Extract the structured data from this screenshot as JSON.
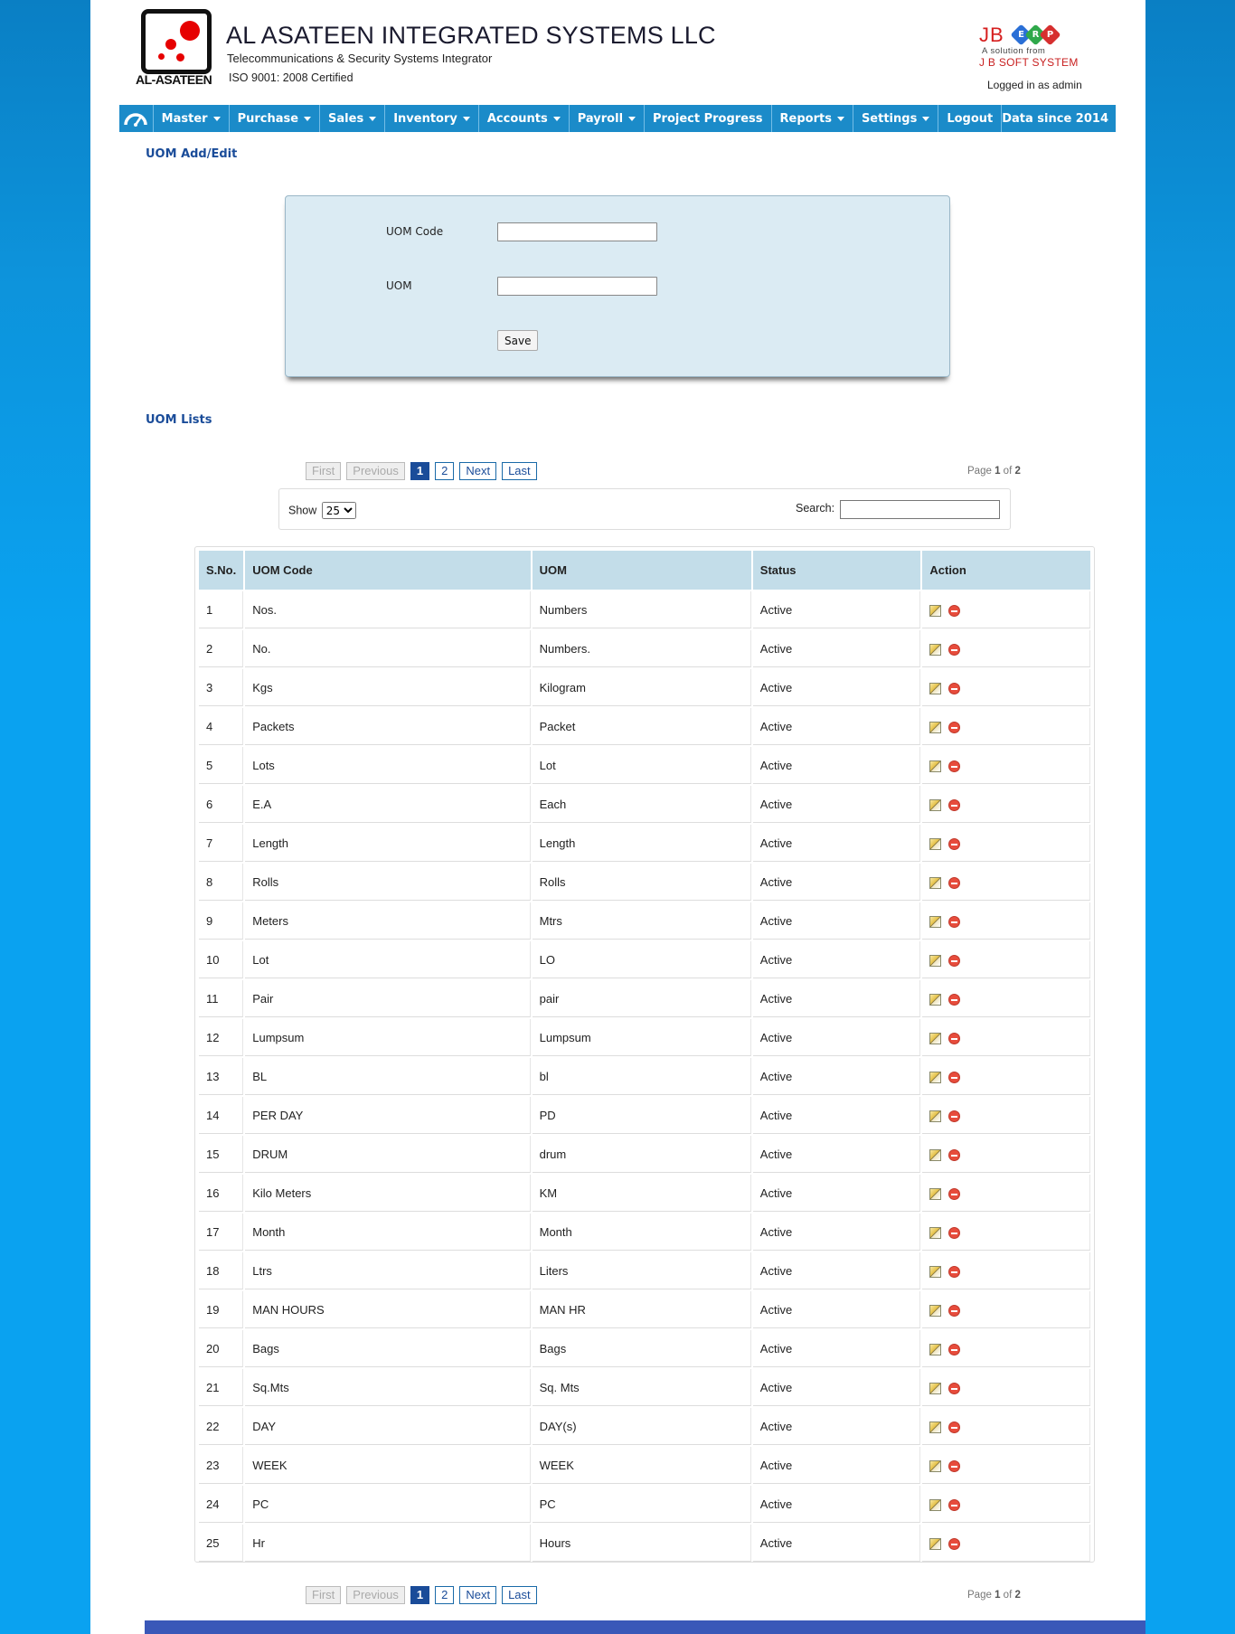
{
  "header": {
    "logo_text": "AL-ASATEEN",
    "company_name": "AL ASATEEN INTEGRATED SYSTEMS LLC",
    "tagline": "Telecommunications & Security Systems Integrator",
    "iso": "ISO 9001: 2008 Certified",
    "erp_brand": "JB",
    "erp_letters": [
      "E",
      "R",
      "P"
    ],
    "erp_sub1": "A solution from",
    "erp_sub2": "J B SOFT SYSTEM",
    "logged_in": "Logged in as admin"
  },
  "nav": {
    "home_icon": "dashboard-icon",
    "items": [
      {
        "label": "Master",
        "dropdown": true
      },
      {
        "label": "Purchase",
        "dropdown": true
      },
      {
        "label": "Sales",
        "dropdown": true
      },
      {
        "label": "Inventory",
        "dropdown": true
      },
      {
        "label": "Accounts",
        "dropdown": true
      },
      {
        "label": "Payroll",
        "dropdown": true
      },
      {
        "label": "Project Progress",
        "dropdown": false
      },
      {
        "label": "Reports",
        "dropdown": true
      },
      {
        "label": "Settings",
        "dropdown": true
      },
      {
        "label": "Logout",
        "dropdown": false
      }
    ],
    "data_since": "Data since 2014"
  },
  "form": {
    "title": "UOM Add/Edit",
    "uom_code_label": "UOM Code",
    "uom_code_value": "",
    "uom_label": "UOM",
    "uom_value": "",
    "save_label": "Save"
  },
  "list": {
    "title": "UOM Lists",
    "pager": {
      "first": "First",
      "previous": "Previous",
      "pages": [
        "1",
        "2"
      ],
      "current": "1",
      "next": "Next",
      "last": "Last"
    },
    "page_of": {
      "prefix": "Page",
      "current": "1",
      "mid": "of",
      "total": "2"
    },
    "show_label": "Show",
    "show_value": "25",
    "search_label": "Search:",
    "search_value": "",
    "columns": [
      "S.No.",
      "UOM Code",
      "UOM",
      "Status",
      "Action"
    ],
    "rows": [
      [
        "1",
        "Nos.",
        "Numbers",
        "Active"
      ],
      [
        "2",
        "No.",
        "Numbers.",
        "Active"
      ],
      [
        "3",
        "Kgs",
        "Kilogram",
        "Active"
      ],
      [
        "4",
        "Packets",
        "Packet",
        "Active"
      ],
      [
        "5",
        "Lots",
        "Lot",
        "Active"
      ],
      [
        "6",
        "E.A",
        "Each",
        "Active"
      ],
      [
        "7",
        "Length",
        "Length",
        "Active"
      ],
      [
        "8",
        "Rolls",
        "Rolls",
        "Active"
      ],
      [
        "9",
        "Meters",
        "Mtrs",
        "Active"
      ],
      [
        "10",
        "Lot",
        "LO",
        "Active"
      ],
      [
        "11",
        "Pair",
        "pair",
        "Active"
      ],
      [
        "12",
        "Lumpsum",
        "Lumpsum",
        "Active"
      ],
      [
        "13",
        "BL",
        "bl",
        "Active"
      ],
      [
        "14",
        "PER DAY",
        "PD",
        "Active"
      ],
      [
        "15",
        "DRUM",
        "drum",
        "Active"
      ],
      [
        "16",
        "Kilo Meters",
        "KM",
        "Active"
      ],
      [
        "17",
        "Month",
        "Month",
        "Active"
      ],
      [
        "18",
        "Ltrs",
        "Liters",
        "Active"
      ],
      [
        "19",
        "MAN HOURS",
        "MAN HR",
        "Active"
      ],
      [
        "20",
        "Bags",
        "Bags",
        "Active"
      ],
      [
        "21",
        "Sq.Mts",
        "Sq. Mts",
        "Active"
      ],
      [
        "22",
        "DAY",
        "DAY(s)",
        "Active"
      ],
      [
        "23",
        "WEEK",
        "WEEK",
        "Active"
      ],
      [
        "24",
        "PC",
        "PC",
        "Active"
      ],
      [
        "25",
        "Hr",
        "Hours",
        "Active"
      ]
    ]
  },
  "colors": {
    "nav": "#1b8bc9",
    "header_cell": "#c3dde9",
    "form_bg": "#dbebf3",
    "title": "#1a4c99"
  }
}
